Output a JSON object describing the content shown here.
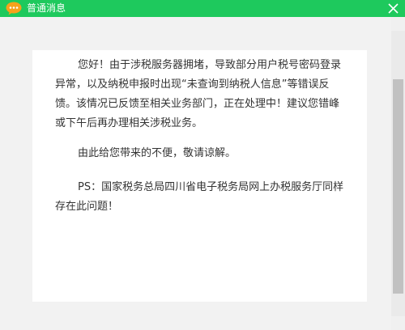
{
  "window": {
    "title": "普通消息",
    "title_bar_color": "#1ec95d",
    "icon": "chat-bubble-icon",
    "close_icon": "close-icon"
  },
  "message": {
    "paragraph1": "您好！由于涉税服务器拥堵，导致部分用户税号密码登录异常，以及纳税申报时出现“未查询到纳税人信息”等错误反馈。该情况已反馈至相关业务部门，正在处理中！建议您错峰或下午后再办理相关涉税业务。",
    "paragraph2": "由此给您带来的不便，敬请谅解。",
    "paragraph3": "PS：国家税务总局四川省电子税务局网上办税服务厅同样存在此问题！"
  }
}
